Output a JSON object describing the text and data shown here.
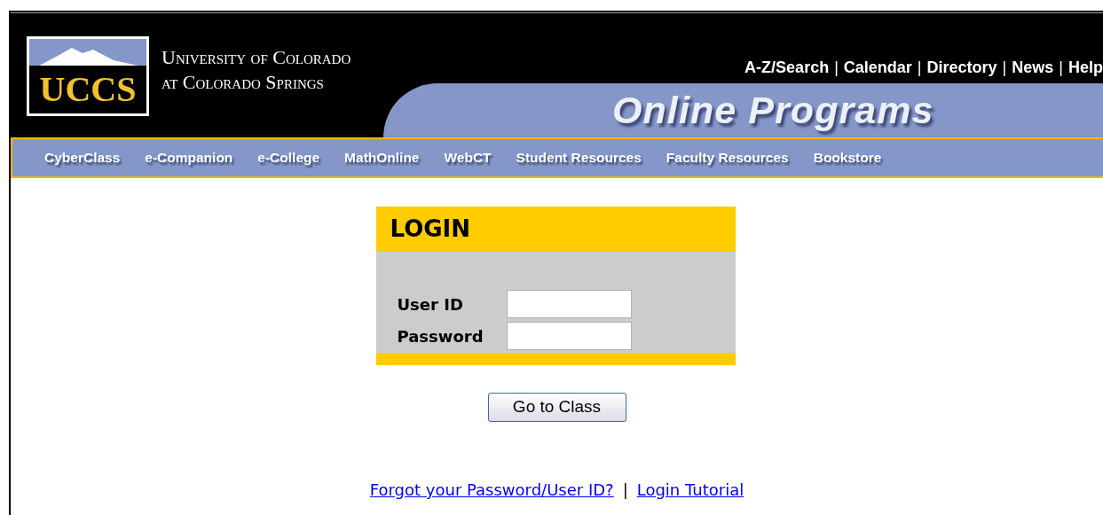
{
  "header": {
    "logo_text": "UCCS",
    "university_name": [
      "University of Colorado",
      "at Colorado Springs"
    ],
    "top_links": [
      "A-Z/Search",
      "Calendar",
      "Directory",
      "News",
      "Help"
    ],
    "top_link_separator": "|",
    "banner_title": "Online Programs"
  },
  "nav": [
    "CyberClass",
    "e-Companion",
    "e-College",
    "MathOnline",
    "WebCT",
    "Student Resources",
    "Faculty Resources",
    "Bookstore"
  ],
  "login": {
    "title": "LOGIN",
    "fields": [
      {
        "label": "User ID"
      },
      {
        "label": "Password"
      }
    ],
    "button": "Go to Class"
  },
  "footer_links": [
    "Forgot your Password/User ID?",
    "Login Tutorial"
  ],
  "footer_separator": "|"
}
